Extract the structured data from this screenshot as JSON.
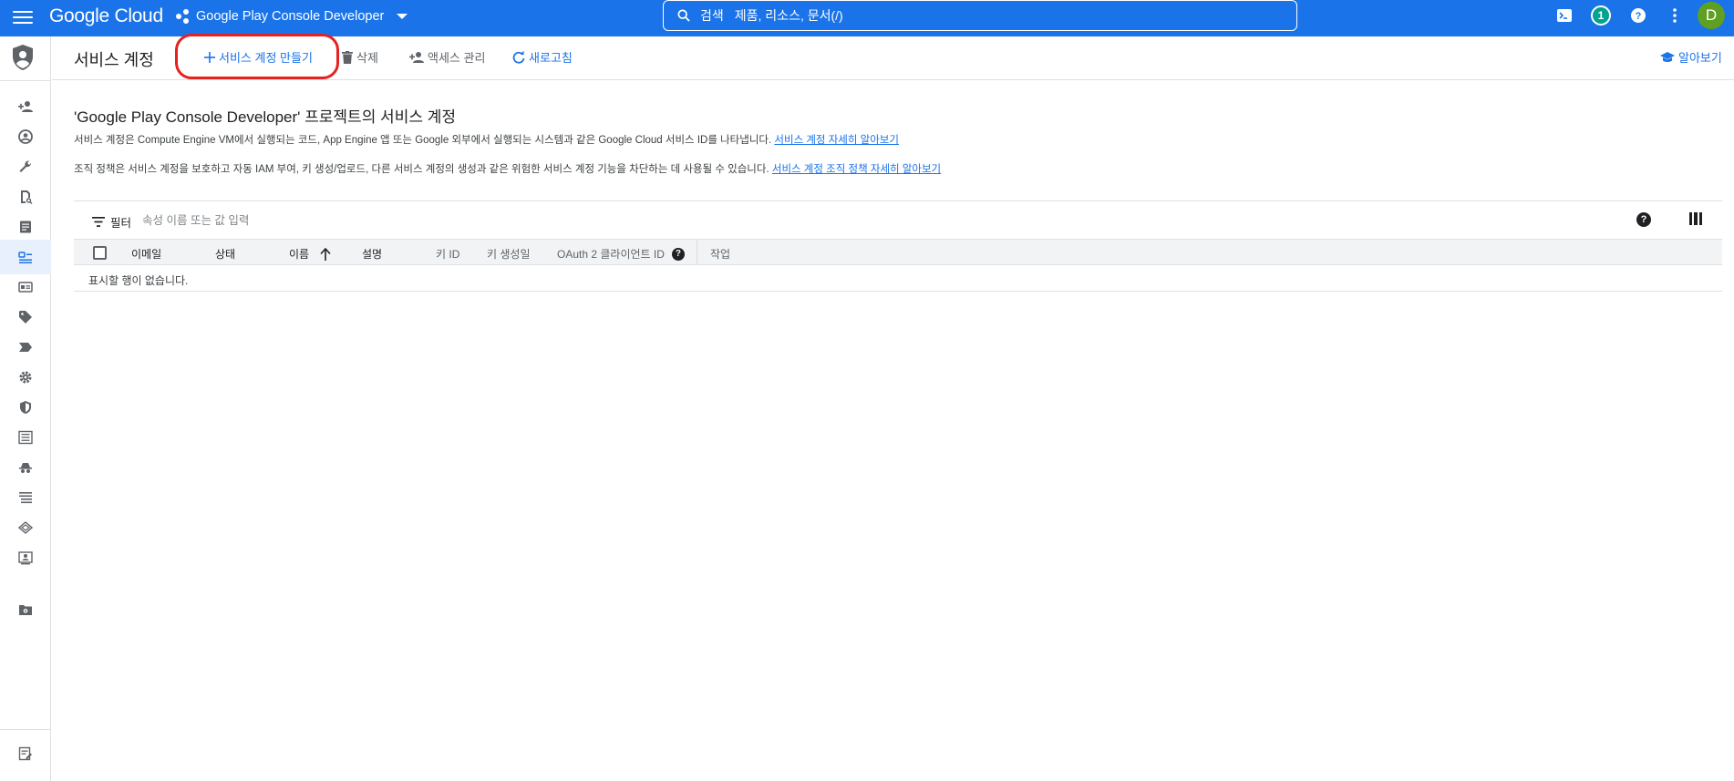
{
  "topbar": {
    "logo": "Google Cloud",
    "project": "Google Play Console Developer",
    "search_label": "검색",
    "search_placeholder": "제품, 리소스, 문서(/)",
    "notification_count": "1",
    "avatar_letter": "D",
    "brand_color": "#1a73e8"
  },
  "toolbar": {
    "title": "서비스 계정",
    "create_label": "서비스 계정 만들기",
    "delete_label": "삭제",
    "access_label": "액세스 관리",
    "refresh_label": "새로고침",
    "learn_label": "알아보기"
  },
  "main": {
    "heading": "'Google Play Console Developer' 프로젝트의 서비스 계정",
    "desc1": "서비스 계정은 Compute Engine VM에서 실행되는 코드, App Engine 앱 또는 Google 외부에서 실행되는 시스템과 같은 Google Cloud 서비스 ID를 나타냅니다.",
    "desc1_link": "서비스 계정 자세히 알아보기",
    "desc2": "조직 정책은 서비스 계정을 보호하고 자동 IAM 부여, 키 생성/업로드, 다른 서비스 계정의 생성과 같은 위험한 서비스 계정 기능을 차단하는 데 사용될 수 있습니다.",
    "desc2_link": "서비스 계정 조직 정책 자세히 알아보기"
  },
  "filter": {
    "label": "필터",
    "placeholder": "속성 이름 또는 값 입력"
  },
  "table": {
    "columns": [
      "이메일",
      "상태",
      "이름",
      "설명",
      "키 ID",
      "키 생성일",
      "OAuth 2 클라이언트 ID",
      "작업"
    ],
    "empty_message": "표시할 행이 없습니다."
  },
  "rail": {
    "items": [
      "add-member-icon",
      "account-circle-icon",
      "wrench-icon",
      "policy-doc-icon",
      "article-icon",
      "service-account-icon",
      "badge-icon",
      "tag-icon",
      "label-icon",
      "settings-icon",
      "security-shield-icon",
      "list-box-icon",
      "incognito-icon",
      "list-icon",
      "layers-icon",
      "person-card-icon",
      "folder-gear-icon",
      "release-notes-icon"
    ]
  }
}
